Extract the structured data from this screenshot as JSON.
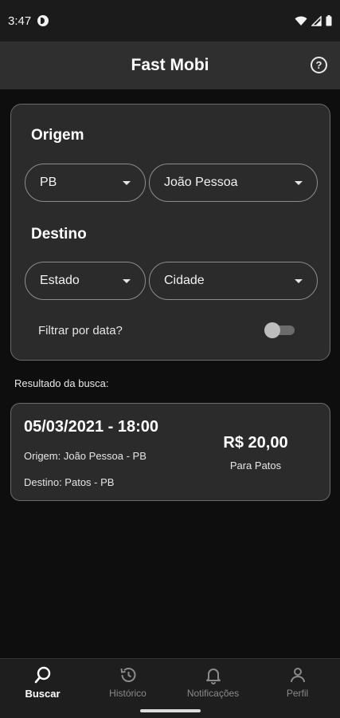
{
  "status_bar": {
    "time": "3:47"
  },
  "app_bar": {
    "title": "Fast Mobi",
    "help_glyph": "?"
  },
  "search": {
    "origin_label": "Origem",
    "origin_state": "PB",
    "origin_city": "João Pessoa",
    "destination_label": "Destino",
    "destination_state": "Estado",
    "destination_city": "Cidade",
    "filter_label": "Filtrar por data?",
    "filter_enabled": false
  },
  "results": {
    "label": "Resultado da busca:",
    "items": [
      {
        "datetime": "05/03/2021 - 18:00",
        "origin": "Origem: João Pessoa - PB",
        "destination": "Destino: Patos - PB",
        "price": "R$ 20,00",
        "price_sub": "Para Patos"
      }
    ]
  },
  "bottom_nav": {
    "items": [
      {
        "label": "Buscar",
        "icon": "search-icon",
        "active": true
      },
      {
        "label": "Histórico",
        "icon": "history-icon",
        "active": false
      },
      {
        "label": "Notificações",
        "icon": "bell-icon",
        "active": false
      },
      {
        "label": "Perfil",
        "icon": "person-icon",
        "active": false
      }
    ]
  },
  "colors": {
    "background": "#0e0e0e",
    "card": "#2b2b2b",
    "app_bar": "#2f2f2f",
    "text": "#ffffff",
    "inactive_nav": "#8a8a8a"
  }
}
